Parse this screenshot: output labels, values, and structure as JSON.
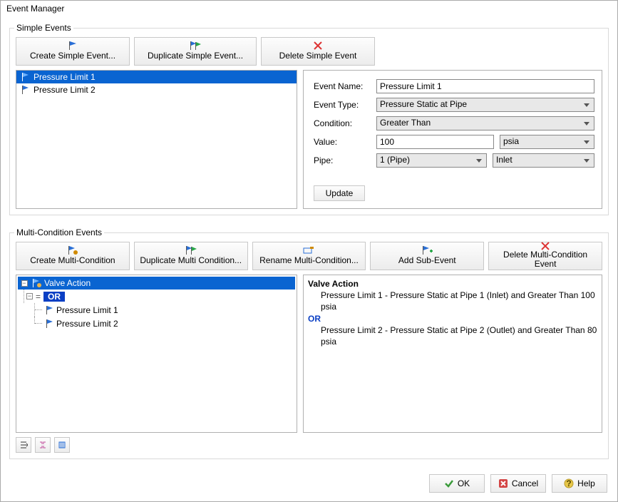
{
  "window_title": "Event Manager",
  "simple": {
    "group_label": "Simple Events",
    "buttons": {
      "create": "Create Simple Event...",
      "duplicate": "Duplicate Simple Event...",
      "delete": "Delete Simple Event"
    },
    "items": [
      "Pressure Limit 1",
      "Pressure Limit 2"
    ],
    "selected_index": 0,
    "form": {
      "name_label": "Event Name:",
      "name_value": "Pressure Limit 1",
      "type_label": "Event Type:",
      "type_value": "Pressure Static at Pipe",
      "condition_label": "Condition:",
      "condition_value": "Greater Than",
      "value_label": "Value:",
      "value_value": "100",
      "unit_value": "psia",
      "pipe_label": "Pipe:",
      "pipe_value": "1 (Pipe)",
      "pipe_loc_value": "Inlet",
      "update_label": "Update"
    }
  },
  "multi": {
    "group_label": "Multi-Condition Events",
    "buttons": {
      "create": "Create Multi-Condition",
      "duplicate": "Duplicate Multi Condition...",
      "rename": "Rename Multi-Condition...",
      "addsub": "Add Sub-Event",
      "delete": "Delete Multi-Condition Event"
    },
    "tree": {
      "root": "Valve Action",
      "op": "OR",
      "children": [
        "Pressure Limit 1",
        "Pressure Limit 2"
      ]
    },
    "desc": {
      "title": "Valve Action",
      "line1": "Pressure Limit 1 - Pressure Static at Pipe 1 (Inlet) and Greater Than 100 psia",
      "or": "OR",
      "line2": "Pressure Limit 2 - Pressure Static at Pipe 2 (Outlet) and Greater Than 80 psia"
    }
  },
  "footer": {
    "ok": "OK",
    "cancel": "Cancel",
    "help": "Help"
  }
}
